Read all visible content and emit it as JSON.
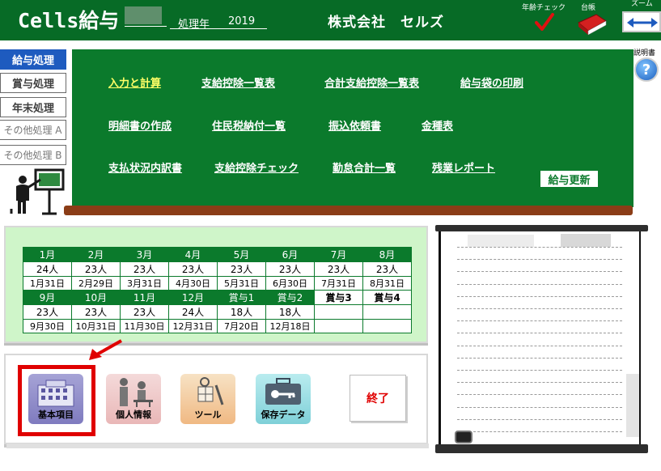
{
  "header": {
    "app_title": "Cells給与",
    "year_label": "処理年",
    "year_value": "2019",
    "company": "株式会社　セルズ",
    "age_check_label": "年齢チェック",
    "daicho_label": "台帳",
    "zoom_label": "ズーム"
  },
  "sidebar": {
    "items": [
      {
        "label": "給与処理",
        "state": "active"
      },
      {
        "label": "賞与処理",
        "state": "normal"
      },
      {
        "label": "年末処理",
        "state": "normal"
      },
      {
        "label": "その他処理 A",
        "state": "muted"
      },
      {
        "label": "その他処理 B",
        "state": "muted"
      }
    ]
  },
  "board": {
    "links": [
      "入力と計算",
      "支給控除一覧表",
      "合計支給控除一覧表",
      "給与袋の印刷",
      "明細書の作成",
      "住民税納付一覧",
      "振込依頼書",
      "金種表",
      "支払状況内訳書",
      "支給控除チェック",
      "勤怠合計一覧",
      "残業レポート"
    ],
    "update_button": "給与更新"
  },
  "help": {
    "label": "説明書"
  },
  "months": {
    "row1": [
      {
        "name": "1月",
        "count": "24人",
        "date": "1月31日"
      },
      {
        "name": "2月",
        "count": "23人",
        "date": "2月29日"
      },
      {
        "name": "3月",
        "count": "23人",
        "date": "3月31日"
      },
      {
        "name": "4月",
        "count": "23人",
        "date": "4月30日"
      },
      {
        "name": "5月",
        "count": "23人",
        "date": "5月31日"
      },
      {
        "name": "6月",
        "count": "23人",
        "date": "6月30日"
      },
      {
        "name": "7月",
        "count": "23人",
        "date": "7月31日"
      },
      {
        "name": "8月",
        "count": "23人",
        "date": "8月31日"
      }
    ],
    "row2": [
      {
        "name": "9月",
        "count": "23人",
        "date": "9月30日"
      },
      {
        "name": "10月",
        "count": "23人",
        "date": "10月31日"
      },
      {
        "name": "11月",
        "count": "23人",
        "date": "11月30日"
      },
      {
        "name": "12月",
        "count": "24人",
        "date": "12月31日"
      },
      {
        "name": "賞与1",
        "count": "18人",
        "date": "7月20日"
      },
      {
        "name": "賞与2",
        "count": "18人",
        "date": "12月18日"
      },
      {
        "name": "賞与3",
        "count": "",
        "date": ""
      },
      {
        "name": "賞与4",
        "count": "",
        "date": ""
      }
    ]
  },
  "buttons": {
    "kihon": "基本項目",
    "kojin": "個人情報",
    "tool": "ツール",
    "hozon": "保存データ",
    "end": "終了"
  },
  "colors": {
    "header_green": "#076b26",
    "board_green": "#0b7a2c",
    "active_blue": "#1e5bbf",
    "highlight_red": "#e00000",
    "link_yellow": "#ffff66"
  }
}
